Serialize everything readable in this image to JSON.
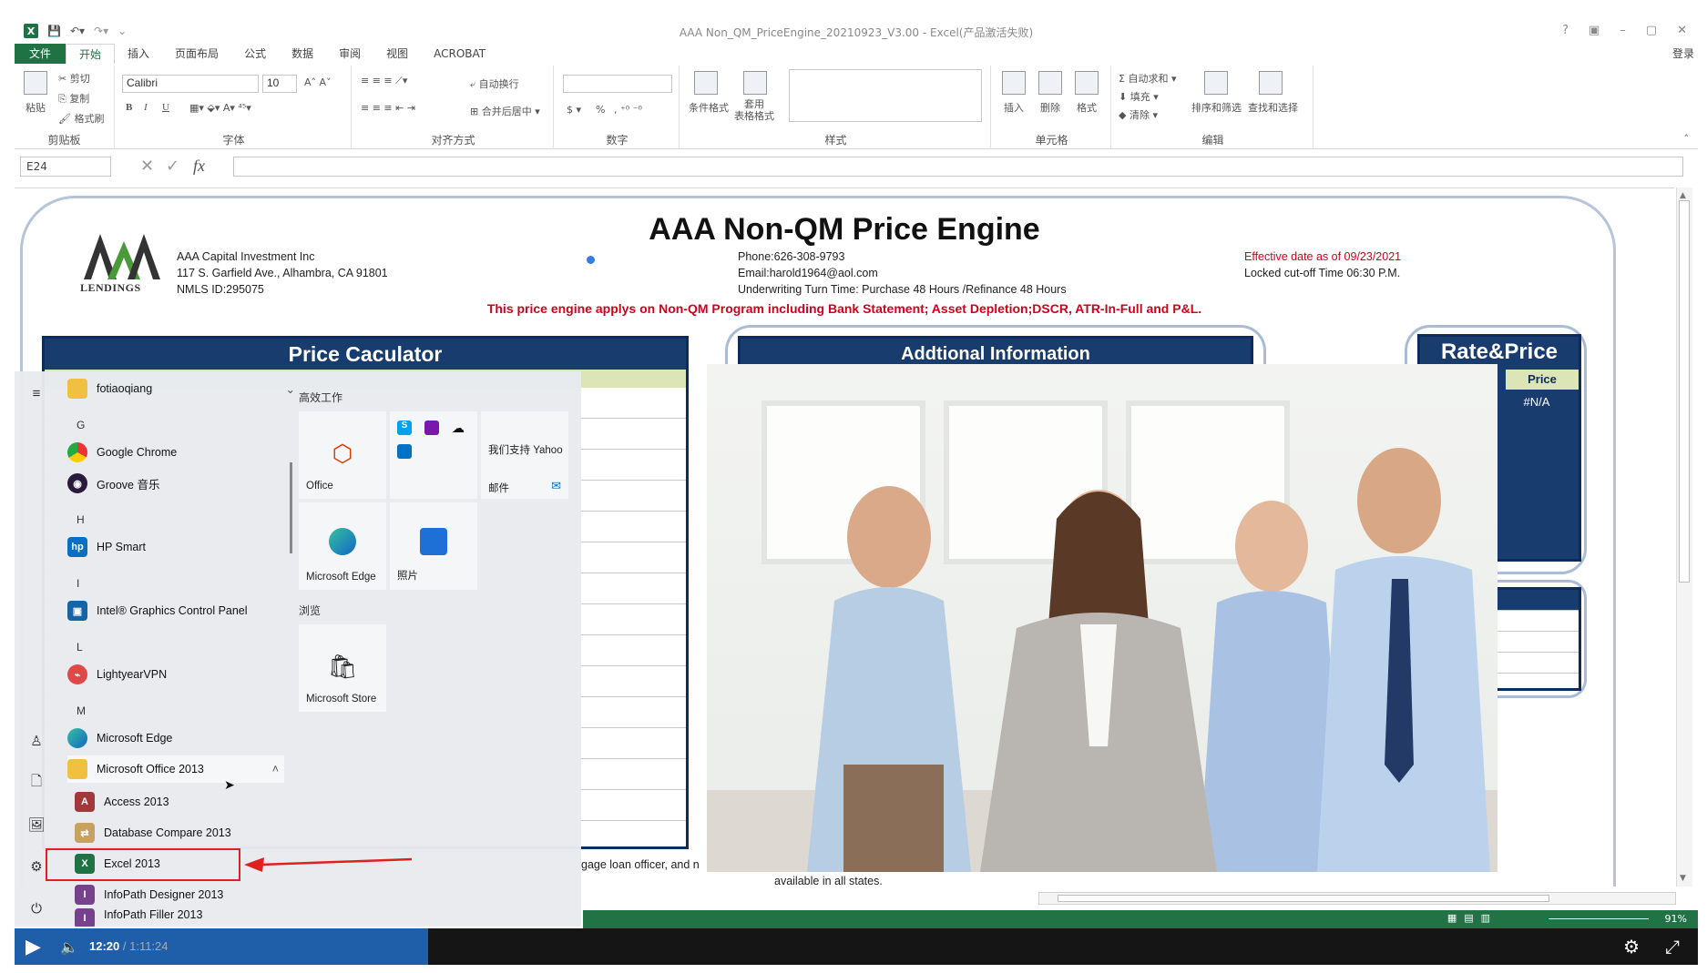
{
  "window": {
    "title": "AAA Non_QM_PriceEngine_20210923_V3.00 - Excel(产品激活失败)",
    "controls": [
      "?",
      "▣",
      "–",
      "▢",
      "✕"
    ]
  },
  "menu": {
    "file": "文件",
    "tabs": [
      "开始",
      "插入",
      "页面布局",
      "公式",
      "数据",
      "审阅",
      "视图",
      "ACROBAT"
    ],
    "login": "登录"
  },
  "ribbon": {
    "clipboard": {
      "label": "剪贴板",
      "paste": "粘贴",
      "cut": "剪切",
      "copy": "复制",
      "painter": "格式刷"
    },
    "font": {
      "label": "字体",
      "name": "Calibri",
      "size": "10",
      "bold": "B",
      "italic": "I",
      "underline": "U"
    },
    "alignment": {
      "label": "对齐方式",
      "wrap": "自动换行",
      "merge": "合并后居中"
    },
    "number": {
      "label": "数字",
      "currency": "$",
      "percent": "%"
    },
    "styles": {
      "label": "样式",
      "conditional": "条件格式",
      "table": "套用\n表格格式"
    },
    "cells": {
      "label": "单元格",
      "insert": "插入",
      "delete": "删除",
      "format": "格式"
    },
    "editing": {
      "label": "编辑",
      "autosum": "自动求和",
      "fill": "填充",
      "clear": "清除",
      "sort": "排序和筛选",
      "find": "查找和选择"
    }
  },
  "formula": {
    "cell_ref": "E24",
    "fx": "fx",
    "value": ""
  },
  "sheet": {
    "title": "AAA Non-QM Price Engine",
    "logo_text": "LENDINGS",
    "company": [
      "AAA  Capital Investment Inc",
      "117 S. Garfield Ave., Alhambra, CA 91801",
      "NMLS ID:295075"
    ],
    "contact": [
      "Phone:626-308-9793",
      "Email:harold1964@aol.com",
      "Underwriting Turn Time: Purchase 48 Hours /Refinance 48 Hours"
    ],
    "effective": "Effective date as of 09/23/2021",
    "cutoff": "Locked cut-off Time 06:30 P.M.",
    "notice": "This price engine applys on Non-QM Program including Bank Statement; Asset Depletion;DSCR, ATR-In-Full and P&L.",
    "price_calc_title": "Price Caculator",
    "additional_title": "Addtional Information",
    "rate_price_title": "Rate&Price",
    "price_header": "Price",
    "price_value": "#N/A",
    "footer_left": "gage loan officer, and n",
    "footer_right": "available in all states."
  },
  "statusbar": {
    "zoom": "91%"
  },
  "start_menu": {
    "apps": [
      {
        "label": "fotiaoqiang",
        "icon": "folder-icon"
      },
      {
        "label": "Google Chrome",
        "icon": "chrome-icon"
      },
      {
        "label": "Groove 音乐",
        "icon": "groove-icon"
      },
      {
        "label": "HP Smart",
        "icon": "hp-icon"
      },
      {
        "label": "Intel® Graphics Control Panel",
        "icon": "intel-icon"
      },
      {
        "label": "LightyearVPN",
        "icon": "vpn-icon"
      },
      {
        "label": "Microsoft Edge",
        "icon": "edge-icon"
      },
      {
        "label": "Microsoft Office 2013",
        "icon": "folder-icon"
      },
      {
        "label": "Access 2013",
        "icon": "access-icon"
      },
      {
        "label": "Database Compare 2013",
        "icon": "dbcompare-icon"
      },
      {
        "label": "Excel 2013",
        "icon": "excel-icon"
      },
      {
        "label": "InfoPath Designer 2013",
        "icon": "infopath-icon"
      },
      {
        "label": "InfoPath Filler 2013",
        "icon": "infopath-icon"
      }
    ],
    "letters": [
      "G",
      "H",
      "I",
      "L",
      "M"
    ],
    "tile_groups": [
      "高效工作",
      "浏览"
    ],
    "tiles": {
      "office": "Office",
      "yahoo": "我们支持 Yahoo",
      "mail": "邮件",
      "edge": "Microsoft Edge",
      "photos": "照片",
      "store": "Microsoft Store"
    }
  },
  "player": {
    "current": "12:20",
    "total": "/ 1:11:24",
    "progress": 0.17
  }
}
